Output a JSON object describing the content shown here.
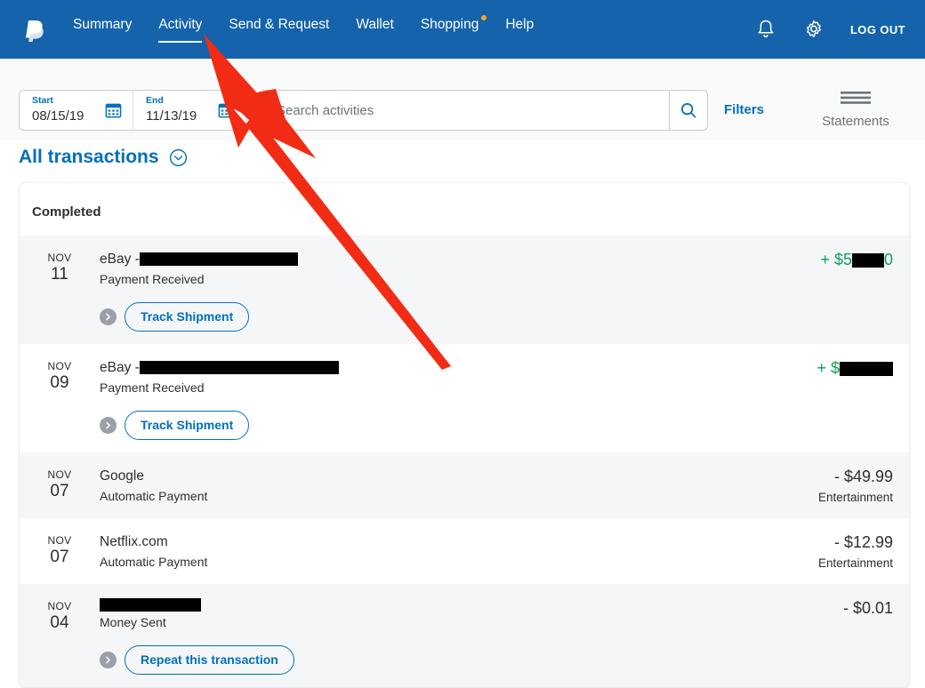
{
  "nav": {
    "logo_icon": "paypal-logo-icon",
    "links": [
      {
        "label": "Summary",
        "active": false,
        "dot": false
      },
      {
        "label": "Activity",
        "active": true,
        "dot": false
      },
      {
        "label": "Send & Request",
        "active": false,
        "dot": false
      },
      {
        "label": "Wallet",
        "active": false,
        "dot": false
      },
      {
        "label": "Shopping",
        "active": false,
        "dot": true
      },
      {
        "label": "Help",
        "active": false,
        "dot": false
      }
    ],
    "bell_icon": "notification-bell-icon",
    "gear_icon": "settings-gear-icon",
    "logout_label": "LOG OUT"
  },
  "toolbar": {
    "start_label": "Start",
    "start_value": "08/15/19",
    "end_label": "End",
    "end_value": "11/13/19",
    "calendar_icon": "calendar-icon",
    "search_placeholder": "Search activities",
    "search_value": "",
    "search_icon": "magnifier-icon",
    "filters_label": "Filters",
    "statements_label": "Statements",
    "statements_icon": "hamburger-lines-icon"
  },
  "section": {
    "all_transactions_label": "All transactions",
    "chevron_icon": "chevron-down-circle-icon"
  },
  "card": {
    "title": "Completed",
    "transactions": [
      {
        "month": "NOV",
        "day": "11",
        "name_prefix": "eBay - ",
        "name_redacted": true,
        "redact_width": 178,
        "subtitle": "Payment Received",
        "action_label": "Track Shipment",
        "action_icon": "chevron-right-circle-icon",
        "amount_sign": "+",
        "amount_text": "$5",
        "amount_redacted": true,
        "amount_redact_width": 36,
        "amount_suffix": "0",
        "amount_positive": true,
        "category": "",
        "shaded": true
      },
      {
        "month": "NOV",
        "day": "09",
        "name_prefix": "eBay - ",
        "name_redacted": true,
        "redact_width": 224,
        "subtitle": "Payment Received",
        "action_label": "Track Shipment",
        "action_icon": "chevron-right-circle-icon",
        "amount_sign": "+",
        "amount_text": "$",
        "amount_redacted": true,
        "amount_redact_width": 60,
        "amount_suffix": "",
        "amount_positive": true,
        "category": "",
        "shaded": false
      },
      {
        "month": "NOV",
        "day": "07",
        "name_prefix": "Google",
        "name_redacted": false,
        "redact_width": 0,
        "subtitle": "Automatic Payment",
        "action_label": "",
        "action_icon": "",
        "amount_sign": "-",
        "amount_text": "$49.99",
        "amount_redacted": false,
        "amount_redact_width": 0,
        "amount_suffix": "",
        "amount_positive": false,
        "category": "Entertainment",
        "shaded": true
      },
      {
        "month": "NOV",
        "day": "07",
        "name_prefix": "Netflix.com",
        "name_redacted": false,
        "redact_width": 0,
        "subtitle": "Automatic Payment",
        "action_label": "",
        "action_icon": "",
        "amount_sign": "-",
        "amount_text": "$12.99",
        "amount_redacted": false,
        "amount_redact_width": 0,
        "amount_suffix": "",
        "amount_positive": false,
        "category": "Entertainment",
        "shaded": false
      },
      {
        "month": "NOV",
        "day": "04",
        "name_prefix": "",
        "name_redacted": true,
        "redact_width": 114,
        "subtitle": "Money Sent",
        "action_label": "Repeat this transaction",
        "action_icon": "chevron-right-circle-icon",
        "amount_sign": "-",
        "amount_text": "$0.01",
        "amount_redacted": false,
        "amount_redact_width": 0,
        "amount_suffix": "",
        "amount_positive": false,
        "category": "",
        "shaded": true
      }
    ]
  },
  "annotation": {
    "arrow_icon": "red-arrow-pointer",
    "color": "#f22c14",
    "points_to": "Activity"
  },
  "colors": {
    "nav_background": "#1463ab",
    "accent_blue": "#0070ba",
    "positive_green": "#0f9d58",
    "row_shade": "#f5f6f8",
    "text_primary": "#2c2e2f"
  }
}
